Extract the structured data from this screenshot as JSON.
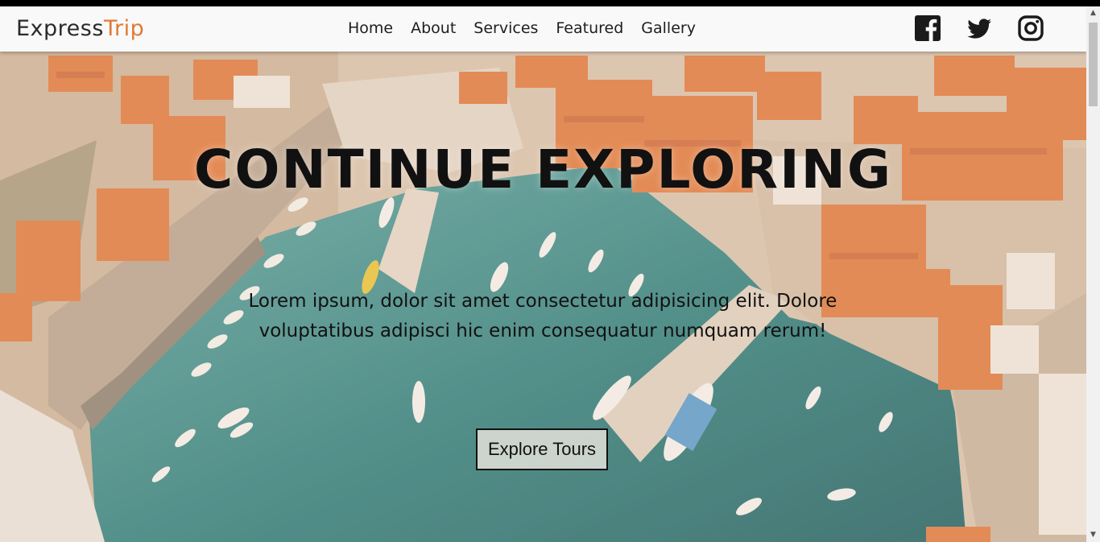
{
  "brand": {
    "part1": "Express",
    "part2": "Trip"
  },
  "nav": {
    "items": [
      {
        "label": "Home"
      },
      {
        "label": "About"
      },
      {
        "label": "Services"
      },
      {
        "label": "Featured"
      },
      {
        "label": "Gallery"
      }
    ],
    "social": [
      "facebook-icon",
      "twitter-icon",
      "instagram-icon"
    ]
  },
  "hero": {
    "title": "CONTINUE EXPLORING",
    "text": "Lorem ipsum, dolor sit amet consectetur adipisicing elit. Dolore voluptatibus adipisci hic enim consequatur numquam rerum!",
    "button_label": "Explore Tours"
  },
  "colors": {
    "accent": "#e07a35",
    "water": "#2f7f7d",
    "roof": "#e07a3f",
    "navbar": "#f9f9f9"
  }
}
